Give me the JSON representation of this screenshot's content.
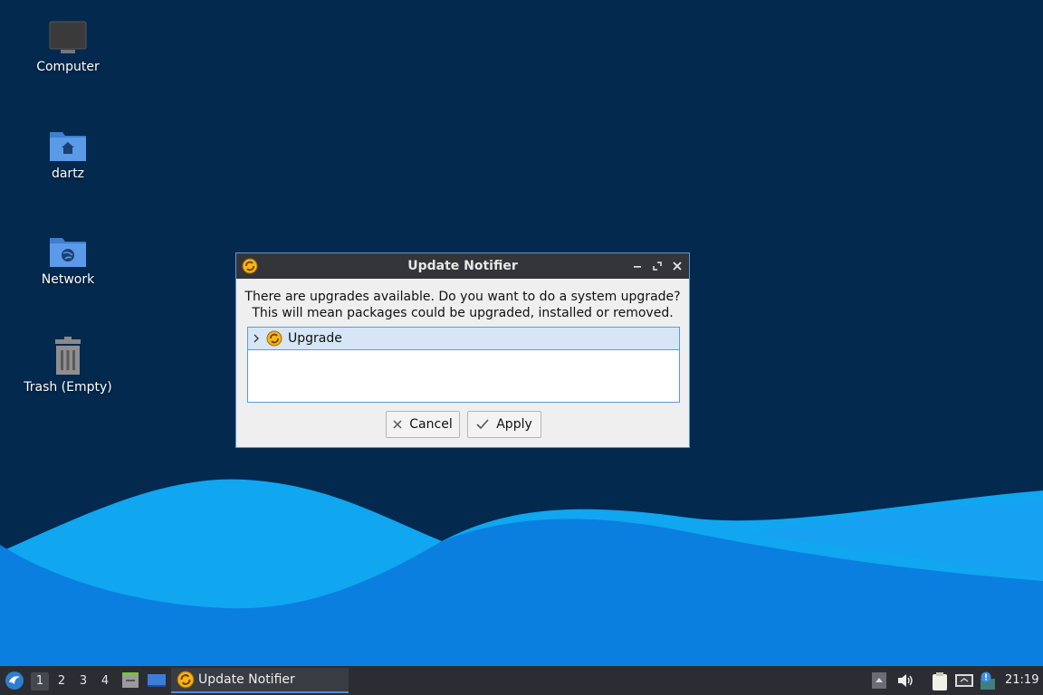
{
  "desktop": {
    "icons": [
      {
        "label": "Computer"
      },
      {
        "label": "dartz"
      },
      {
        "label": "Network"
      },
      {
        "label": "Trash (Empty)"
      }
    ]
  },
  "dialog": {
    "title": "Update Notifier",
    "message_line1": "There are upgrades available. Do you want to do a system upgrade?",
    "message_line2": "This will mean packages could be upgraded, installed or removed.",
    "tree_item": "Upgrade",
    "cancel_label": "Cancel",
    "apply_label": "Apply"
  },
  "taskbar": {
    "workspaces": [
      "1",
      "2",
      "3",
      "4"
    ],
    "active_workspace": "1",
    "task_label": "Update Notifier",
    "clock": "21:19"
  },
  "colors": {
    "desktop_bg": "#03294f",
    "wave_light": "#0fa0ee",
    "wave_main": "#0a7fe0",
    "titlebar": "#33353a",
    "selection": "#d6e6f7",
    "accent": "#5b9bd5"
  }
}
